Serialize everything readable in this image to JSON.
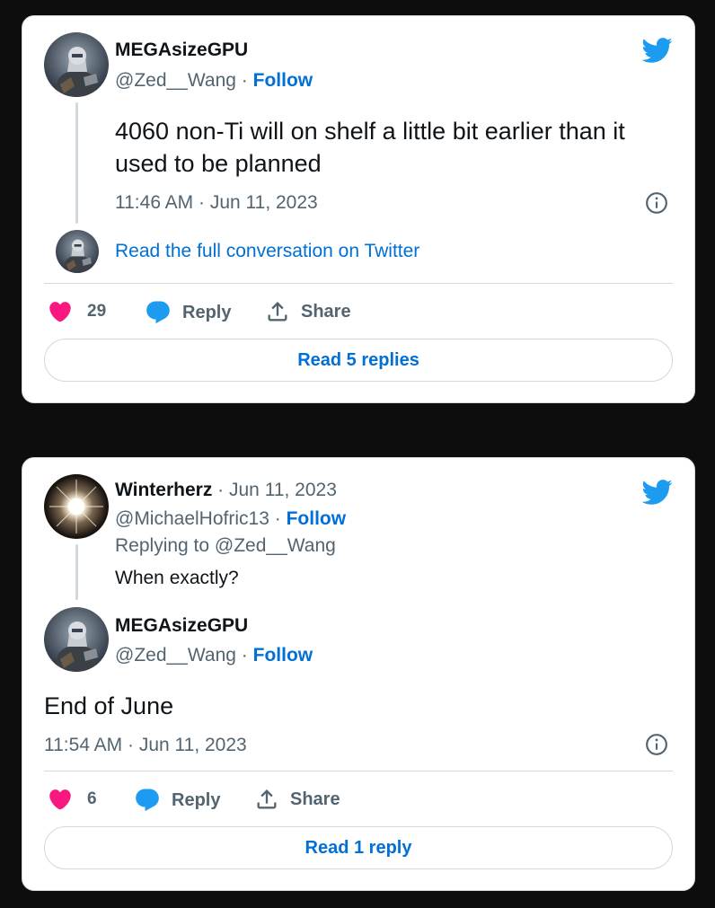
{
  "colors": {
    "background": "#0d0d0d",
    "card": "#ffffff",
    "link_blue": "#006fd6",
    "twitter_blue": "#1d9bf0",
    "heart_pink": "#f91880",
    "muted_gray": "#536471",
    "border": "#cfd9de"
  },
  "tweet1": {
    "author": {
      "name": "MEGAsizeGPU",
      "handle": "@Zed__Wang",
      "separator": "·",
      "follow_label": "Follow",
      "avatar_icon": "robot-avatar"
    },
    "text": "4060 non-Ti will on shelf a little bit earlier than it used to be planned",
    "timestamp": "11:46 AM · Jun 11, 2023",
    "read_conversation": "Read the full conversation on Twitter",
    "actions": {
      "like_count": "29",
      "reply_label": "Reply",
      "share_label": "Share"
    },
    "read_replies_label": "Read 5 replies"
  },
  "tweet2": {
    "reply_author": {
      "name": "Winterherz",
      "date": "· Jun 11, 2023",
      "handle": "@MichaelHofric13",
      "separator": "·",
      "follow_label": "Follow",
      "avatar_icon": "light-orb-avatar"
    },
    "replying_to": "Replying to @Zed__Wang",
    "reply_text": "When exactly?",
    "author": {
      "name": "MEGAsizeGPU",
      "handle": "@Zed__Wang",
      "separator": "·",
      "follow_label": "Follow",
      "avatar_icon": "robot-avatar"
    },
    "text": "End of June",
    "timestamp": "11:54 AM · Jun 11, 2023",
    "actions": {
      "like_count": "6",
      "reply_label": "Reply",
      "share_label": "Share"
    },
    "read_replies_label": "Read 1 reply"
  }
}
